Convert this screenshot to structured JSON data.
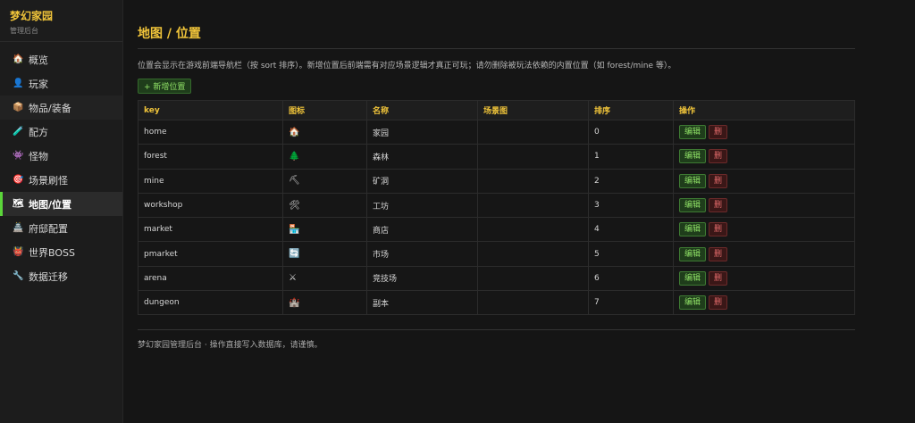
{
  "brand": {
    "title": "梦幻家园",
    "subtitle": "管理后台"
  },
  "sidebar": {
    "items": [
      {
        "icon": "🏠",
        "label": "概览"
      },
      {
        "icon": "👤",
        "label": "玩家"
      },
      {
        "icon": "📦",
        "label": "物品/装备"
      },
      {
        "icon": "🧪",
        "label": "配方"
      },
      {
        "icon": "👾",
        "label": "怪物"
      },
      {
        "icon": "🎯",
        "label": "场景刷怪"
      },
      {
        "icon": "🗺",
        "label": "地图/位置"
      },
      {
        "icon": "🏯",
        "label": "府邸配置"
      },
      {
        "icon": "👹",
        "label": "世界BOSS"
      },
      {
        "icon": "🔧",
        "label": "数据迁移"
      }
    ],
    "active": "地图/位置"
  },
  "page": {
    "title": "地图 / 位置",
    "notice": "位置会显示在游戏前端导航栏（按 sort 排序）。新增位置后前端需有对应场景逻辑才真正可玩；请勿删除被玩法依赖的内置位置（如 forest/mine 等）。",
    "add_label": "+ 新增位置"
  },
  "table": {
    "headers": [
      "key",
      "图标",
      "名称",
      "场景图",
      "排序",
      "操作"
    ],
    "edit_label": "编辑",
    "delete_label": "删",
    "rows": [
      {
        "key": "home",
        "icon": "🏠",
        "name": "家园",
        "scene": "",
        "sort": "0"
      },
      {
        "key": "forest",
        "icon": "🌲",
        "name": "森林",
        "scene": "",
        "sort": "1"
      },
      {
        "key": "mine",
        "icon": "⛏",
        "name": "矿洞",
        "scene": "",
        "sort": "2"
      },
      {
        "key": "workshop",
        "icon": "🛠",
        "name": "工坊",
        "scene": "",
        "sort": "3"
      },
      {
        "key": "market",
        "icon": "🏪",
        "name": "商店",
        "scene": "",
        "sort": "4"
      },
      {
        "key": "pmarket",
        "icon": "🔄",
        "name": "市场",
        "scene": "",
        "sort": "5"
      },
      {
        "key": "arena",
        "icon": "⚔",
        "name": "竞技场",
        "scene": "",
        "sort": "6"
      },
      {
        "key": "dungeon",
        "icon": "🏰",
        "name": "副本",
        "scene": "",
        "sort": "7"
      }
    ]
  },
  "footer": {
    "text": "梦幻家园管理后台 · 操作直接写入数据库，请谨慎。"
  },
  "colors": {
    "accent": "#f0c43a",
    "active_bar": "#5bd63a",
    "edit": "#8fe066",
    "delete": "#e06a6a"
  }
}
